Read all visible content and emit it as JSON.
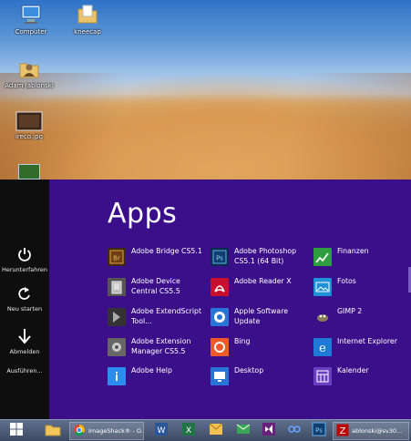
{
  "desktop": {
    "icons": [
      {
        "label": "Computer",
        "icon": "computer-icon"
      },
      {
        "label": "kneecap",
        "icon": "folder-icon"
      },
      {
        "label": "Adam Jablonski",
        "icon": "user-folder-icon"
      },
      {
        "label": "ireco.jpg",
        "icon": "image-file-icon"
      }
    ]
  },
  "power": {
    "items": [
      {
        "label": "Herunterfahren",
        "icon": "power-icon"
      },
      {
        "label": "Neu starten",
        "icon": "restart-icon"
      },
      {
        "label": "Abmelden",
        "icon": "logoff-arrow-icon"
      },
      {
        "label": "Ausführen...",
        "icon": ""
      }
    ]
  },
  "apps": {
    "title": "Apps",
    "columns": [
      [
        {
          "name": "Adobe Bridge CS5.1",
          "icon": "adobe-bridge-icon",
          "color": "#5a3e1b"
        },
        {
          "name": "Adobe Device Central CS5.5",
          "icon": "adobe-device-central-icon",
          "color": "#7f8c8d"
        },
        {
          "name": "Adobe ExtendScript Tool...",
          "icon": "adobe-extendscript-icon",
          "color": "#4a4a6a"
        },
        {
          "name": "Adobe Extension Manager CS5.5",
          "icon": "adobe-extension-manager-icon",
          "color": "#6b6b6b"
        },
        {
          "name": "Adobe Help",
          "icon": "info-icon",
          "color": "#2d8cf0"
        }
      ],
      [
        {
          "name": "Adobe Photoshop CS5.1 (64 Bit)",
          "icon": "photoshop-icon",
          "color": "#0f3e6e"
        },
        {
          "name": "Adobe Reader X",
          "icon": "adobe-reader-icon",
          "color": "#c8102e"
        },
        {
          "name": "Apple Software Update",
          "icon": "apple-update-icon",
          "color": "#2a74d8"
        },
        {
          "name": "Bing",
          "icon": "bing-icon",
          "color": "#f05a28"
        },
        {
          "name": "Desktop",
          "icon": "desktop-icon",
          "color": "#2a74d8"
        }
      ],
      [
        {
          "name": "Finanzen",
          "icon": "finance-chart-icon",
          "color": "#2e9e3e"
        },
        {
          "name": "Fotos",
          "icon": "photos-icon",
          "color": "#1f8fd8"
        },
        {
          "name": "GIMP 2",
          "icon": "gimp-icon",
          "color": "#8a7a5a"
        },
        {
          "name": "Internet Explorer",
          "icon": "internet-explorer-icon",
          "color": "#1e7ad6"
        },
        {
          "name": "Kalender",
          "icon": "calendar-icon",
          "color": "#6a3fc0"
        }
      ]
    ]
  },
  "taskbar": {
    "items": [
      {
        "label": "",
        "icon": "windows-logo-icon"
      },
      {
        "label": "",
        "icon": "file-explorer-icon"
      },
      {
        "label": "ImageShack® - O...",
        "icon": "chrome-icon"
      },
      {
        "label": "",
        "icon": "word-icon"
      },
      {
        "label": "",
        "icon": "excel-icon"
      },
      {
        "label": "",
        "icon": "outlook-icon"
      },
      {
        "label": "",
        "icon": "mail-icon"
      },
      {
        "label": "",
        "icon": "visual-studio-icon"
      },
      {
        "label": "",
        "icon": "network-icon"
      },
      {
        "label": "",
        "icon": "photoshop-icon"
      },
      {
        "label": "ablonski@sv30...",
        "icon": "filezilla-icon"
      }
    ]
  }
}
